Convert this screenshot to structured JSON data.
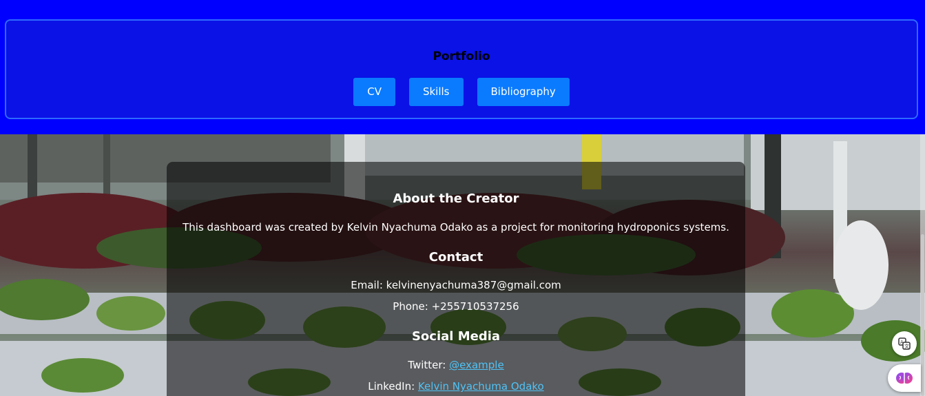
{
  "header": {
    "title": "Portfolio",
    "buttons": [
      {
        "label": "CV"
      },
      {
        "label": "Skills"
      },
      {
        "label": "Bibliography"
      }
    ]
  },
  "about": {
    "heading": "About the Creator",
    "text": "This dashboard was created by Kelvin Nyachuma Odako as a project for monitoring hydroponics systems."
  },
  "contact": {
    "heading": "Contact",
    "email": "Email: kelvinenyachuma387@gmail.com",
    "phone": "Phone: +255710537256"
  },
  "social": {
    "heading": "Social Media",
    "twitter_label": "Twitter:",
    "twitter_link": "@example",
    "linkedin_label": "LinkedIn:",
    "linkedin_link": "Kelvin Nyachuma Odako"
  },
  "floating": {
    "translate_icon": "translate-icon",
    "brain_icon": "brain-icon"
  },
  "colors": {
    "header_bg": "#0000ff",
    "panel_bg": "#0a12e6",
    "button_bg": "#0a7bff",
    "link": "#4fc3f7"
  }
}
